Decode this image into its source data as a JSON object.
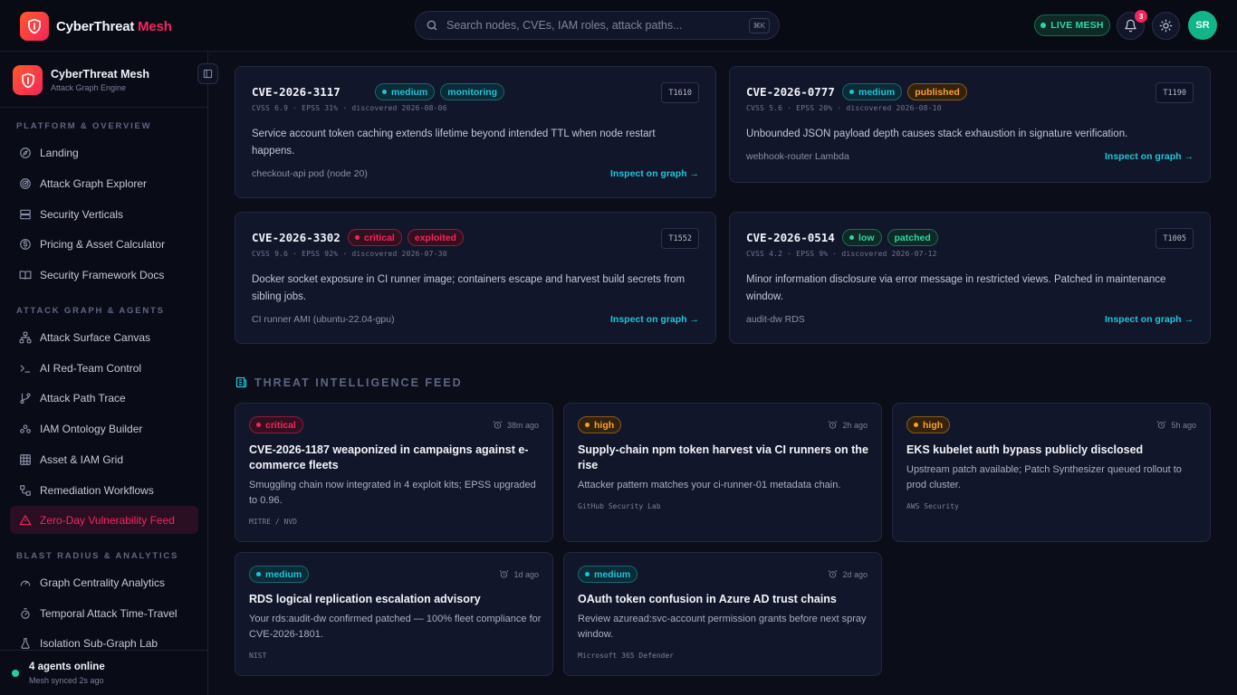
{
  "app": {
    "brand_main": "CyberThreat",
    "brand_accent": "Mesh",
    "search_placeholder": "Search nodes, CVEs, IAM roles, attack paths...",
    "search_shortcut": "⌘K",
    "live_label": "LIVE MESH",
    "notification_count": "3",
    "avatar_initials": "SR"
  },
  "sidebar": {
    "title": "CyberThreat Mesh",
    "subtitle": "Attack Graph Engine",
    "sections": [
      {
        "label": "PLATFORM & OVERVIEW",
        "items": [
          {
            "label": "Landing",
            "icon": "compass-icon"
          },
          {
            "label": "Attack Graph Explorer",
            "icon": "radar-icon"
          },
          {
            "label": "Security Verticals",
            "icon": "server-icon"
          },
          {
            "label": "Pricing & Asset Calculator",
            "icon": "dollar-icon"
          },
          {
            "label": "Security Framework Docs",
            "icon": "book-icon"
          }
        ]
      },
      {
        "label": "ATTACK GRAPH & AGENTS",
        "items": [
          {
            "label": "Attack Surface Canvas",
            "icon": "network-icon"
          },
          {
            "label": "AI Red-Team Control",
            "icon": "terminal-icon"
          },
          {
            "label": "Attack Path Trace",
            "icon": "git-branch-icon"
          },
          {
            "label": "IAM Ontology Builder",
            "icon": "users-icon"
          },
          {
            "label": "Asset & IAM Grid",
            "icon": "grid-icon"
          },
          {
            "label": "Remediation Workflows",
            "icon": "workflow-icon"
          },
          {
            "label": "Zero-Day Vulnerability Feed",
            "icon": "alert-triangle-icon",
            "active": true
          }
        ]
      },
      {
        "label": "BLAST RADIUS & ANALYTICS",
        "items": [
          {
            "label": "Graph Centrality Analytics",
            "icon": "gauge-icon"
          },
          {
            "label": "Temporal Attack Time-Travel",
            "icon": "timer-icon"
          },
          {
            "label": "Isolation Sub-Graph Lab",
            "icon": "flask-icon"
          }
        ]
      }
    ],
    "footer": {
      "status": "4 agents online",
      "sync": "Mesh synced 2s ago"
    }
  },
  "cves": [
    {
      "id": "CVE-2026-3117",
      "severity": "medium",
      "status": "monitoring",
      "technique": "T1610",
      "meta": "CVSS 6.9 · EPSS 31% · discovered 2026-08-06",
      "description": "Service account token caching extends lifetime beyond intended TTL when node restart happens.",
      "asset": "checkout-api pod (node 20)",
      "action": "Inspect on graph →"
    },
    {
      "id": "CVE-2026-0777",
      "severity": "medium",
      "status": "published",
      "technique": "T1190",
      "meta": "CVSS 5.6 · EPSS 20% · discovered 2026-08-10",
      "description": "Unbounded JSON payload depth causes stack exhaustion in signature verification.",
      "asset": "webhook-router Lambda",
      "action": "Inspect on graph →"
    },
    {
      "id": "CVE-2026-3302",
      "severity": "critical",
      "status": "exploited",
      "technique": "T1552",
      "meta": "CVSS 9.6 · EPSS 92% · discovered 2026-07-30",
      "description": "Docker socket exposure in CI runner image; containers escape and harvest build secrets from sibling jobs.",
      "asset": "CI runner AMI (ubuntu-22.04-gpu)",
      "action": "Inspect on graph →"
    },
    {
      "id": "CVE-2026-0514",
      "severity": "low",
      "status": "patched",
      "technique": "T1005",
      "meta": "CVSS 4.2 · EPSS 9% · discovered 2026-07-12",
      "description": "Minor information disclosure via error message in restricted views. Patched in maintenance window.",
      "asset": "audit-dw RDS",
      "action": "Inspect on graph →"
    }
  ],
  "feed": {
    "title": "THREAT INTELLIGENCE FEED",
    "items": [
      {
        "severity": "critical",
        "ago": "38m ago",
        "title": "CVE-2026-1187 weaponized in campaigns against e-commerce fleets",
        "body": "Smuggling chain now integrated in 4 exploit kits; EPSS upgraded to 0.96.",
        "source": "MITRE / NVD"
      },
      {
        "severity": "high",
        "ago": "2h ago",
        "title": "Supply-chain npm token harvest via CI runners on the rise",
        "body": "Attacker pattern matches your ci-runner-01 metadata chain.",
        "source": "GitHub Security Lab"
      },
      {
        "severity": "high",
        "ago": "5h ago",
        "title": "EKS kubelet auth bypass publicly disclosed",
        "body": "Upstream patch available; Patch Synthesizer queued rollout to prod cluster.",
        "source": "AWS Security"
      },
      {
        "severity": "medium",
        "ago": "1d ago",
        "title": "RDS logical replication escalation advisory",
        "body": "Your rds:audit-dw confirmed patched — 100% fleet compliance for CVE-2026-1801.",
        "source": "NIST"
      },
      {
        "severity": "medium",
        "ago": "2d ago",
        "title": "OAuth token confusion in Azure AD trust chains",
        "body": "Review azuread:svc-account permission grants before next spray window.",
        "source": "Microsoft 365 Defender"
      }
    ]
  },
  "colors": {
    "accent": "#f6245e",
    "cyan": "#1ec4d8",
    "green": "#2fd6a0",
    "orange": "#ff9e2c",
    "background": "#0b0d18"
  }
}
